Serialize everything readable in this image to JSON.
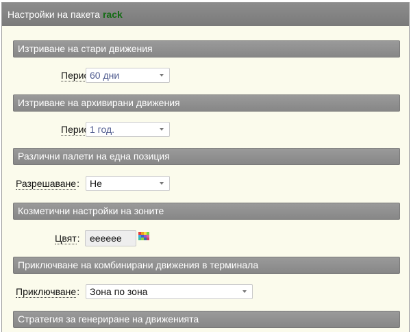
{
  "header": {
    "title": "Настройки на пакета",
    "package": "rack"
  },
  "sections": [
    {
      "title": "Изтриване на стари движения",
      "field_label": "Период",
      "value": "60 дни"
    },
    {
      "title": "Изтриване на архивирани движения",
      "field_label": "Период",
      "value": "1 год."
    },
    {
      "title": "Различни палети на една позиция",
      "field_label": "Разрешаване",
      "value": "Не"
    },
    {
      "title": "Козметични настройки на зоните",
      "field_label": "Цвят",
      "value": "eeeeee"
    },
    {
      "title": "Приключване на комбинирани движения в терминала",
      "field_label": "Приключване",
      "value": "Зона по зона"
    },
    {
      "title": "Стратегия за генериране на движенията"
    }
  ],
  "colors": {
    "header_bg": "#848484",
    "section_bg": "#909090",
    "panel_bg": "#fbfbec",
    "package_name": "#126b12",
    "color_value": "#eeeeee"
  },
  "icons": [
    "chevron-down-icon",
    "color-palette-icon"
  ]
}
